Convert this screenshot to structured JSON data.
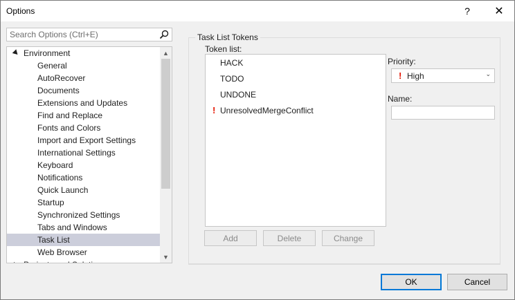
{
  "window": {
    "title": "Options",
    "help_glyph": "?",
    "close_glyph": "✕"
  },
  "search": {
    "placeholder": "Search Options (Ctrl+E)",
    "value": "",
    "icon": "search-icon"
  },
  "tree": {
    "root": "Environment",
    "items": [
      "General",
      "AutoRecover",
      "Documents",
      "Extensions and Updates",
      "Find and Replace",
      "Fonts and Colors",
      "Import and Export Settings",
      "International Settings",
      "Keyboard",
      "Notifications",
      "Quick Launch",
      "Startup",
      "Synchronized Settings",
      "Tabs and Windows",
      "Task List",
      "Web Browser"
    ],
    "selected": "Task List",
    "next_root_partial": "Projects and Solutions"
  },
  "panel": {
    "group_title": "Task List Tokens",
    "token_list_label": "Token list:",
    "tokens": [
      {
        "name": "HACK",
        "high": false
      },
      {
        "name": "TODO",
        "high": false
      },
      {
        "name": "UNDONE",
        "high": false
      },
      {
        "name": "UnresolvedMergeConflict",
        "high": true
      }
    ],
    "priority_label": "Priority:",
    "priority_value": "High",
    "priority_mark": "!",
    "name_label": "Name:",
    "name_value": "",
    "buttons": {
      "add": "Add",
      "delete": "Delete",
      "change": "Change"
    }
  },
  "footer": {
    "ok": "OK",
    "cancel": "Cancel"
  },
  "colors": {
    "selection": "#cccedb",
    "priority_high": "#e51400",
    "accent": "#0078d7"
  }
}
